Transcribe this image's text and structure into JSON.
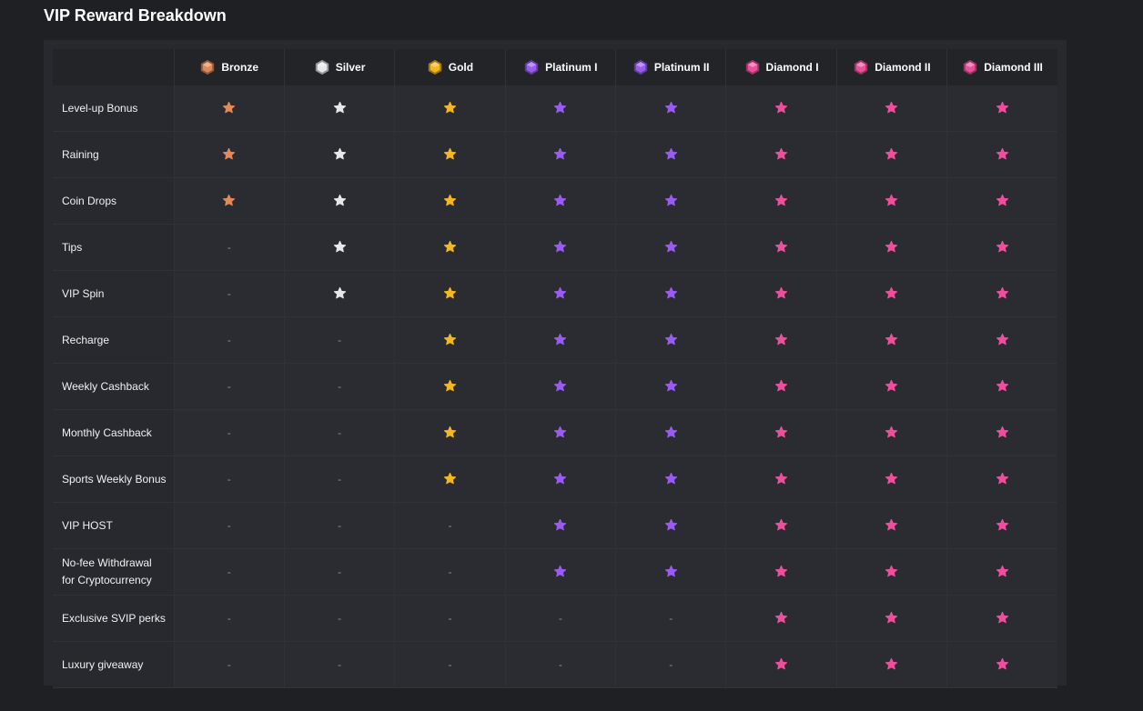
{
  "page": {
    "title": "VIP Reward Breakdown"
  },
  "colors": {
    "bronze": "#e0895a",
    "silver": "#e8e8ea",
    "gold": "#f5b81c",
    "platinum": "#9a5cf0",
    "diamond": "#ee4f9c"
  },
  "tiers": [
    {
      "label": "Bronze",
      "icon": "bronze-hexagon-icon",
      "color": "bronze"
    },
    {
      "label": "Silver",
      "icon": "silver-hexagon-icon",
      "color": "silver"
    },
    {
      "label": "Gold",
      "icon": "gold-hexagon-icon",
      "color": "gold"
    },
    {
      "label": "Platinum I",
      "icon": "platinum-hexagon-icon",
      "color": "platinum"
    },
    {
      "label": "Platinum II",
      "icon": "platinum-hexagon-icon",
      "color": "platinum"
    },
    {
      "label": "Diamond I",
      "icon": "diamond-hexagon-icon",
      "color": "diamond"
    },
    {
      "label": "Diamond II",
      "icon": "diamond-hexagon-icon",
      "color": "diamond"
    },
    {
      "label": "Diamond III",
      "icon": "diamond-hexagon-icon",
      "color": "diamond"
    }
  ],
  "empty_cell": "-",
  "rows": [
    {
      "label": "Level-up Bonus",
      "included": [
        true,
        true,
        true,
        true,
        true,
        true,
        true,
        true
      ]
    },
    {
      "label": "Raining",
      "included": [
        true,
        true,
        true,
        true,
        true,
        true,
        true,
        true
      ]
    },
    {
      "label": "Coin Drops",
      "included": [
        true,
        true,
        true,
        true,
        true,
        true,
        true,
        true
      ]
    },
    {
      "label": "Tips",
      "included": [
        false,
        true,
        true,
        true,
        true,
        true,
        true,
        true
      ]
    },
    {
      "label": "VIP Spin",
      "included": [
        false,
        true,
        true,
        true,
        true,
        true,
        true,
        true
      ]
    },
    {
      "label": "Recharge",
      "included": [
        false,
        false,
        true,
        true,
        true,
        true,
        true,
        true
      ]
    },
    {
      "label": "Weekly Cashback",
      "included": [
        false,
        false,
        true,
        true,
        true,
        true,
        true,
        true
      ]
    },
    {
      "label": "Monthly Cashback",
      "included": [
        false,
        false,
        true,
        true,
        true,
        true,
        true,
        true
      ]
    },
    {
      "label": "Sports Weekly Bonus",
      "included": [
        false,
        false,
        true,
        true,
        true,
        true,
        true,
        true
      ]
    },
    {
      "label": "VIP HOST",
      "included": [
        false,
        false,
        false,
        true,
        true,
        true,
        true,
        true
      ]
    },
    {
      "label": "No-fee Withdrawal for Cryptocurrency",
      "included": [
        false,
        false,
        false,
        true,
        true,
        true,
        true,
        true
      ]
    },
    {
      "label": "Exclusive SVIP perks",
      "included": [
        false,
        false,
        false,
        false,
        false,
        true,
        true,
        true
      ]
    },
    {
      "label": "Luxury giveaway",
      "included": [
        false,
        false,
        false,
        false,
        false,
        true,
        true,
        true
      ]
    }
  ]
}
